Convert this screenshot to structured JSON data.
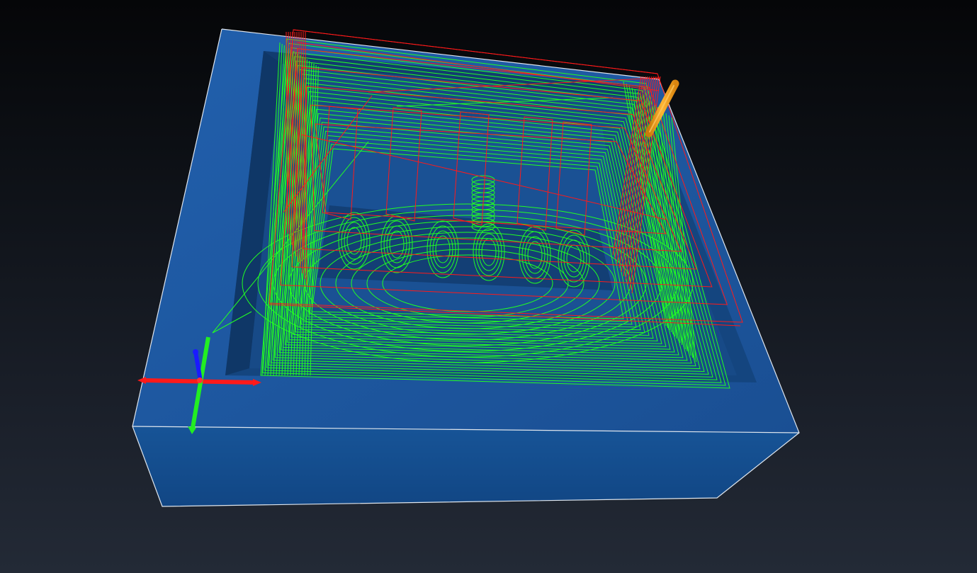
{
  "viewport": {
    "kind": "cam-toolpath-simulation-3d-view"
  },
  "colors": {
    "background_top": "#050608",
    "background_bottom": "#232a36",
    "stock_top": "#1d56a0",
    "stock_front": "#134e90",
    "stock_right": "#0f3f78",
    "stock_edge": "#dfe6ee",
    "pocket_floor": "#143f74",
    "cutting_toolpath": "#22ff22",
    "rapid_toolpath": "#ff1a1a",
    "tool": "#f5a21c",
    "axis_x": "#ff1a1a",
    "axis_y": "#22ee22",
    "axis_z": "#1a1aff"
  },
  "legend_concepts": {
    "stock": "stock-block",
    "cutting_moves": "green-toolpath",
    "rapid_moves": "red-toolpath",
    "tool": "end-mill-tool",
    "origin": "xyz-axis-triad"
  }
}
